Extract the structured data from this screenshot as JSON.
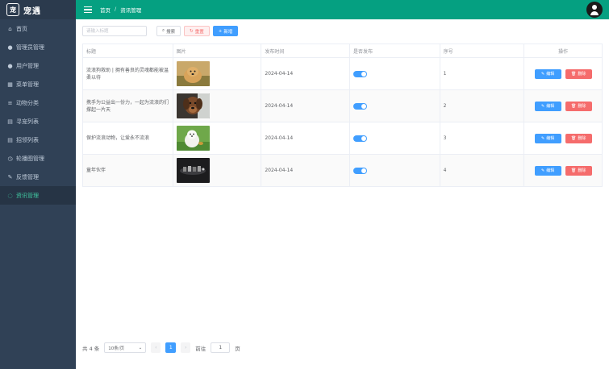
{
  "app": {
    "logo_mark": "宠",
    "name": "宠遇"
  },
  "sidebar": {
    "items": [
      {
        "label": "首页",
        "icon": "home-icon",
        "glyph": "⌂"
      },
      {
        "label": "管理员管理",
        "icon": "user-icon",
        "glyph": "●"
      },
      {
        "label": "用户管理",
        "icon": "user-icon",
        "glyph": "●"
      },
      {
        "label": "菜单管理",
        "icon": "grid-icon",
        "glyph": "▦"
      },
      {
        "label": "动物分类",
        "icon": "menu-icon",
        "glyph": "≡"
      },
      {
        "label": "寻宠列表",
        "icon": "list-icon",
        "glyph": "▤"
      },
      {
        "label": "招领列表",
        "icon": "list-icon",
        "glyph": "▤"
      },
      {
        "label": "轮播图管理",
        "icon": "picture-icon",
        "glyph": "◷"
      },
      {
        "label": "反馈管理",
        "icon": "edit-icon",
        "glyph": "✎"
      },
      {
        "label": "资讯管理",
        "icon": "chat-icon",
        "glyph": "◌"
      }
    ],
    "active_index": 9
  },
  "header": {
    "breadcrumb_home": "首页",
    "breadcrumb_sep": "/",
    "breadcrumb_current": "资讯管理"
  },
  "toolbar": {
    "search_placeholder": "请输入标题",
    "search_label": "搜索",
    "reset_label": "重置",
    "add_label": "新增"
  },
  "table": {
    "columns": [
      "标题",
      "图片",
      "发布时间",
      "是否发布",
      "序号",
      "操作"
    ],
    "rows": [
      {
        "title": "流浪狗救助 | 拥有善良的灵魂都能被温柔以待",
        "date": "2024-04-14",
        "published": true,
        "seq": "1",
        "image": "golden-dog-on-grass"
      },
      {
        "title": "携手为公益出一份力，一起为流浪的们撑起一片天",
        "date": "2024-04-14",
        "published": true,
        "seq": "2",
        "image": "dog-portrait"
      },
      {
        "title": "保护流浪动物，让爱永不流浪",
        "date": "2024-04-14",
        "published": true,
        "seq": "3",
        "image": "white-puppy"
      },
      {
        "title": "童年伙伴",
        "date": "2024-04-14",
        "published": true,
        "seq": "4",
        "image": "dark-group-photo"
      }
    ],
    "edit_label": "编辑",
    "delete_label": "删除"
  },
  "pagination": {
    "total_text": "共 4 条",
    "page_size": "10条/页",
    "current_page": "1",
    "goto_label": "前往",
    "goto_value": "1",
    "page_suffix": "页"
  },
  "colors": {
    "header": "#05a081",
    "sidebar": "#304156",
    "primary": "#409eff",
    "danger": "#f56c6c",
    "active_menu": "#40c9a2"
  }
}
